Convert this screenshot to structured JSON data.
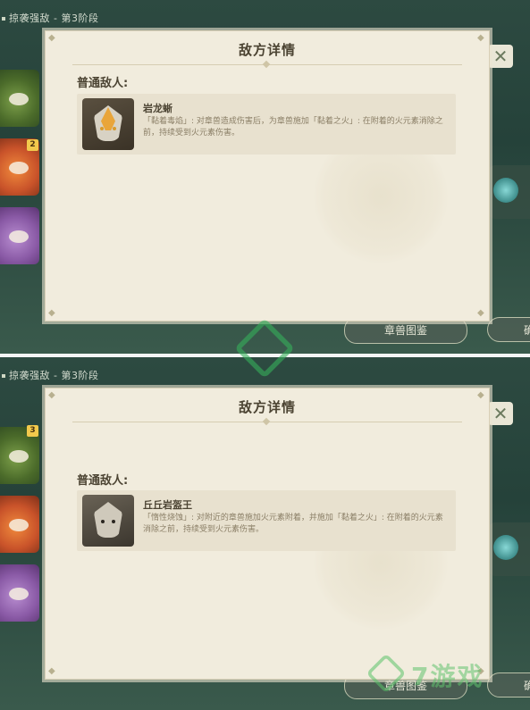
{
  "panels": [
    {
      "stage_label": "掠袭强敌 - 第3阶段",
      "dialog_title": "敌方详情",
      "section_heading": "普通敌人:",
      "enemy": {
        "name": "岩龙蜥",
        "description": "「黏着毒焰」: 对章兽造成伤害后，为章兽施加「黏着之火」: 在附着的火元素消除之前，持续受到火元素伤害。"
      },
      "left_roster": [
        {
          "badge": ""
        },
        {
          "badge": "2"
        },
        {
          "badge": ""
        }
      ],
      "bottom_button": "章兽图鉴",
      "bottom_button_right": "确"
    },
    {
      "stage_label": "掠袭强敌 - 第3阶段",
      "dialog_title": "敌方详情",
      "section_heading": "普通敌人:",
      "enemy": {
        "name": "丘丘岩盔王",
        "description": "「惰性烧蚀」: 对附近的章兽施加火元素附着，并施加「黏着之火」: 在附着的火元素消除之前，持续受到火元素伤害。"
      },
      "left_roster": [
        {
          "badge": "3"
        },
        {
          "badge": ""
        },
        {
          "badge": ""
        }
      ],
      "bottom_button": "章兽图鉴",
      "bottom_button_right": "确"
    }
  ],
  "close_glyph": "✕",
  "watermark_text": "7游戏",
  "colors": {
    "dialog_bg": "#f1ecdd",
    "title_text": "#4c4433",
    "desc_text": "#8a7e66",
    "accent_green": "#5bc36a"
  }
}
